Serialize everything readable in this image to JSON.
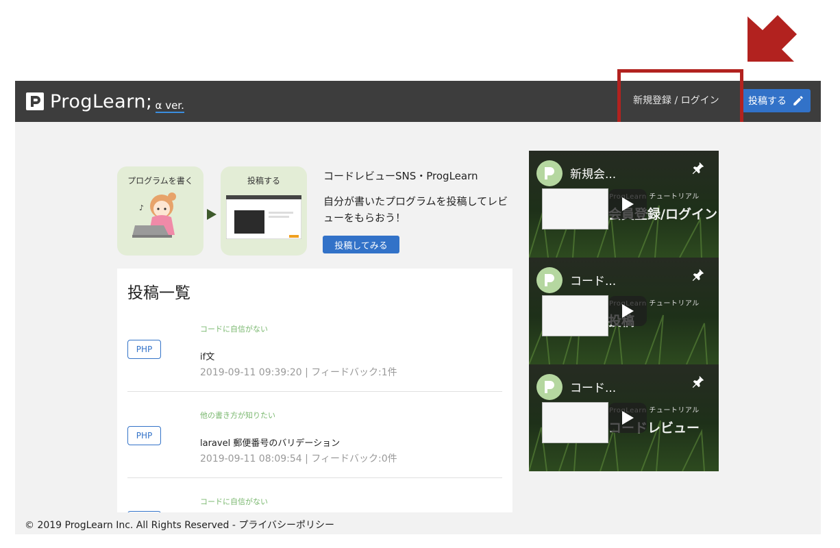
{
  "header": {
    "logo_text": "ProgLearn;",
    "logo_version": "α ver.",
    "login_label": "新規登録 / ログイン",
    "post_label": "投稿する"
  },
  "hero": {
    "card1_title": "プログラムを書く",
    "card2_title": "投稿する",
    "heading": "コードレビューSNS・ProgLearn",
    "description": "自分が書いたプログラムを投稿してレビューをもらおう！",
    "try_label": "投稿してみる"
  },
  "posts": {
    "title": "投稿一覧",
    "items": [
      {
        "category": "コードに自信がない",
        "tag": "PHP",
        "title": "if文",
        "meta": "2019-09-11 09:39:20 | フィードバック:1件"
      },
      {
        "category": "他の書き方が知りたい",
        "tag": "PHP",
        "title": "laravel 郵便番号のバリデーション",
        "meta": "2019-09-11 08:09:54 | フィードバック:0件"
      },
      {
        "category": "コードに自信がない",
        "tag": "PHP",
        "title": "",
        "meta": ""
      }
    ]
  },
  "videos": [
    {
      "title": "新規会...",
      "brand": "ProgLearn チュートリアル",
      "big_text": "会員登録/ログイン"
    },
    {
      "title": "コード...",
      "brand": "ProgLearn チュートリアル",
      "big_text": "投稿"
    },
    {
      "title": "コード...",
      "brand": "ProgLearn チュートリアル",
      "big_text": "コードレビュー"
    }
  ],
  "footer": {
    "text": "© 2019 ProgLearn Inc. All Rights Reserved - プライバシーポリシー"
  },
  "colors": {
    "header_bg": "#3d3d3d",
    "accent_blue": "#3272c8",
    "annotation_red": "#b2221f",
    "category_green": "#7ab86f"
  }
}
